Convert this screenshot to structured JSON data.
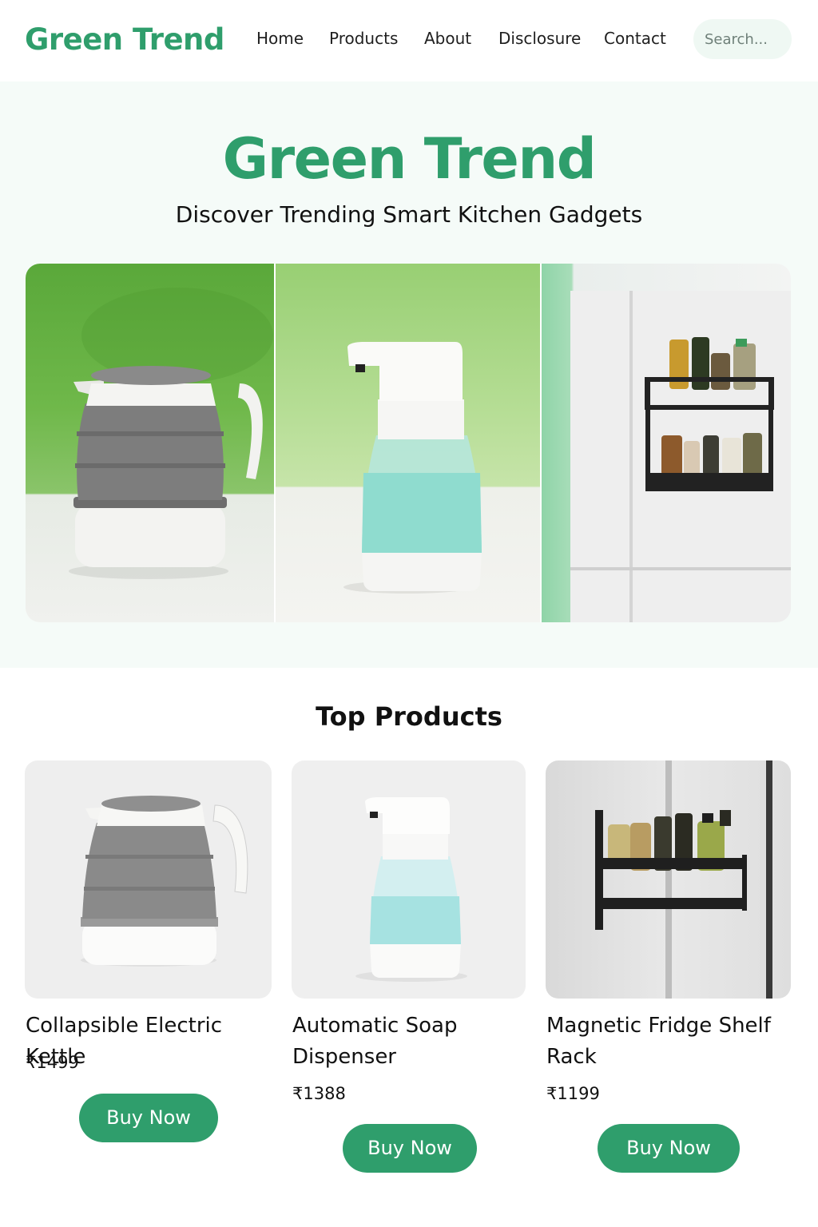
{
  "brand": {
    "logo": "Green Trend",
    "accent_color": "#2f9e6c"
  },
  "nav": {
    "items": [
      {
        "label": "Home"
      },
      {
        "label": "Products"
      },
      {
        "label": "About"
      },
      {
        "label": "Disclosure"
      },
      {
        "label": "Contact"
      }
    ],
    "search_placeholder": "Search..."
  },
  "hero": {
    "title": "Green Trend",
    "subtitle": "Discover Trending Smart Kitchen Gadgets",
    "gallery": [
      {
        "icon": "electric-kettle-icon"
      },
      {
        "icon": "soap-dispenser-icon"
      },
      {
        "icon": "fridge-spice-rack-icon"
      }
    ]
  },
  "products": {
    "section_title": "Top Products",
    "items": [
      {
        "name": "Collapsible  Electric Kettle",
        "price": "₹1499",
        "button": "Buy Now",
        "icon": "electric-kettle-icon"
      },
      {
        "name": "Automatic Soap Dispenser",
        "price": "₹1388",
        "button": "Buy Now",
        "icon": "soap-dispenser-icon"
      },
      {
        "name": "Magnetic Fridge Shelf Rack",
        "price": "₹1199",
        "button": "Buy Now",
        "icon": "fridge-shelf-rack-icon"
      }
    ]
  }
}
